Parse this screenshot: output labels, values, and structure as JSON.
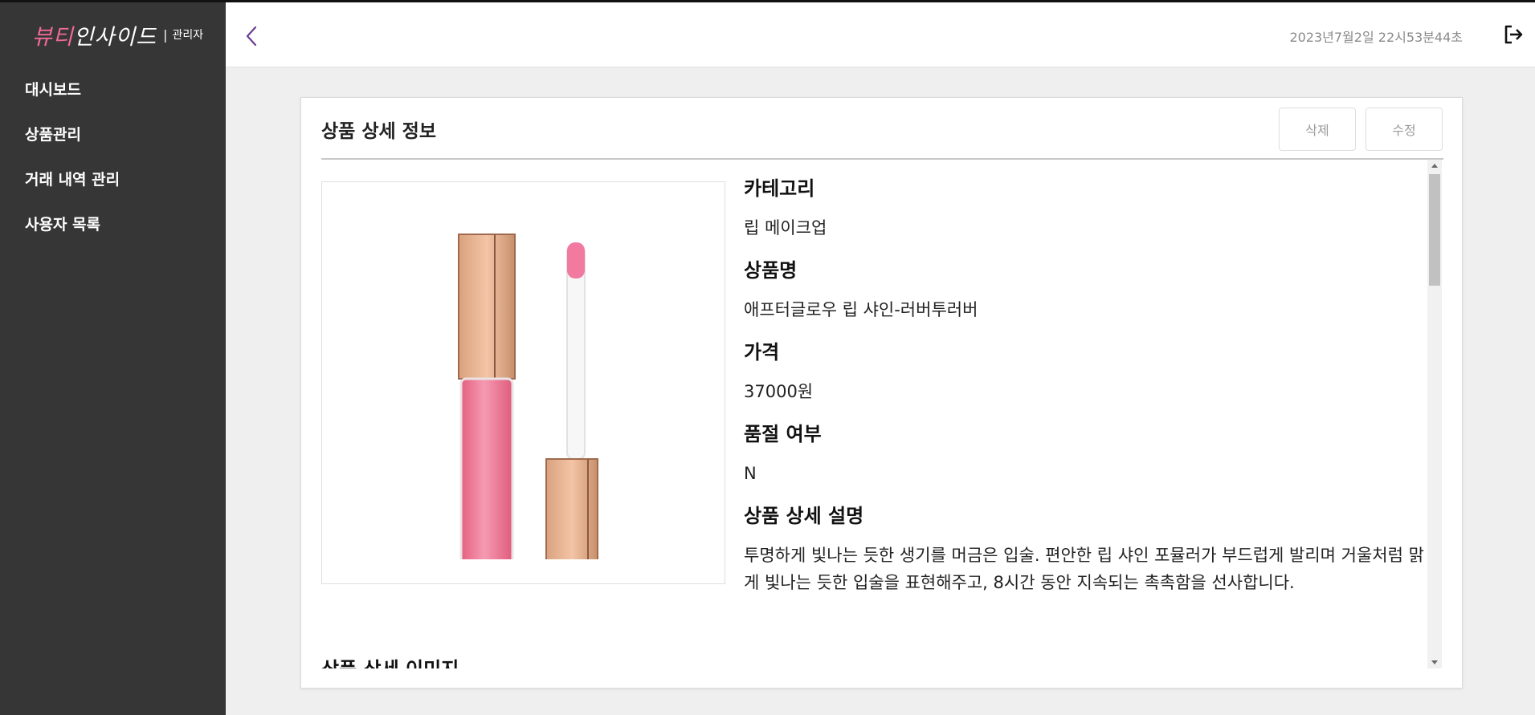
{
  "brand": {
    "logo_accent": "뷰티",
    "logo_rest": "인사이드",
    "separator": "|",
    "role": "관리자"
  },
  "sidebar": {
    "items": [
      {
        "label": "대시보드"
      },
      {
        "label": "상품관리"
      },
      {
        "label": "거래 내역 관리"
      },
      {
        "label": "사용자 목록"
      }
    ]
  },
  "header": {
    "datetime": "2023년7월2일 22시53분44초",
    "back_icon": "chevron-left-icon",
    "logout_icon": "logout-icon"
  },
  "card": {
    "title": "상품 상세 정보",
    "delete_label": "삭제",
    "edit_label": "수정"
  },
  "product": {
    "category_label": "카테고리",
    "category": "립 메이크업",
    "name_label": "상품명",
    "name": "애프터글로우 립 샤인-러버투러버",
    "price_label": "가격",
    "price": "37000원",
    "soldout_label": "품절 여부",
    "soldout": "N",
    "desc_label": "상품 상세 설명",
    "desc": "투명하게 빛나는 듯한 생기를 머금은 입술. 편안한 립 샤인 포뮬러가 부드럽게 발리며 거울처럼 맑게 빛나는 듯한 입술을 표현해주고, 8시간 동안 지속되는 촉촉함을 선사합니다.",
    "detail_image_label": "상품 상세 이미지"
  },
  "colors": {
    "sidebar_bg": "#363636",
    "accent": "#f06a96",
    "back_chevron": "#6b3d8f"
  }
}
